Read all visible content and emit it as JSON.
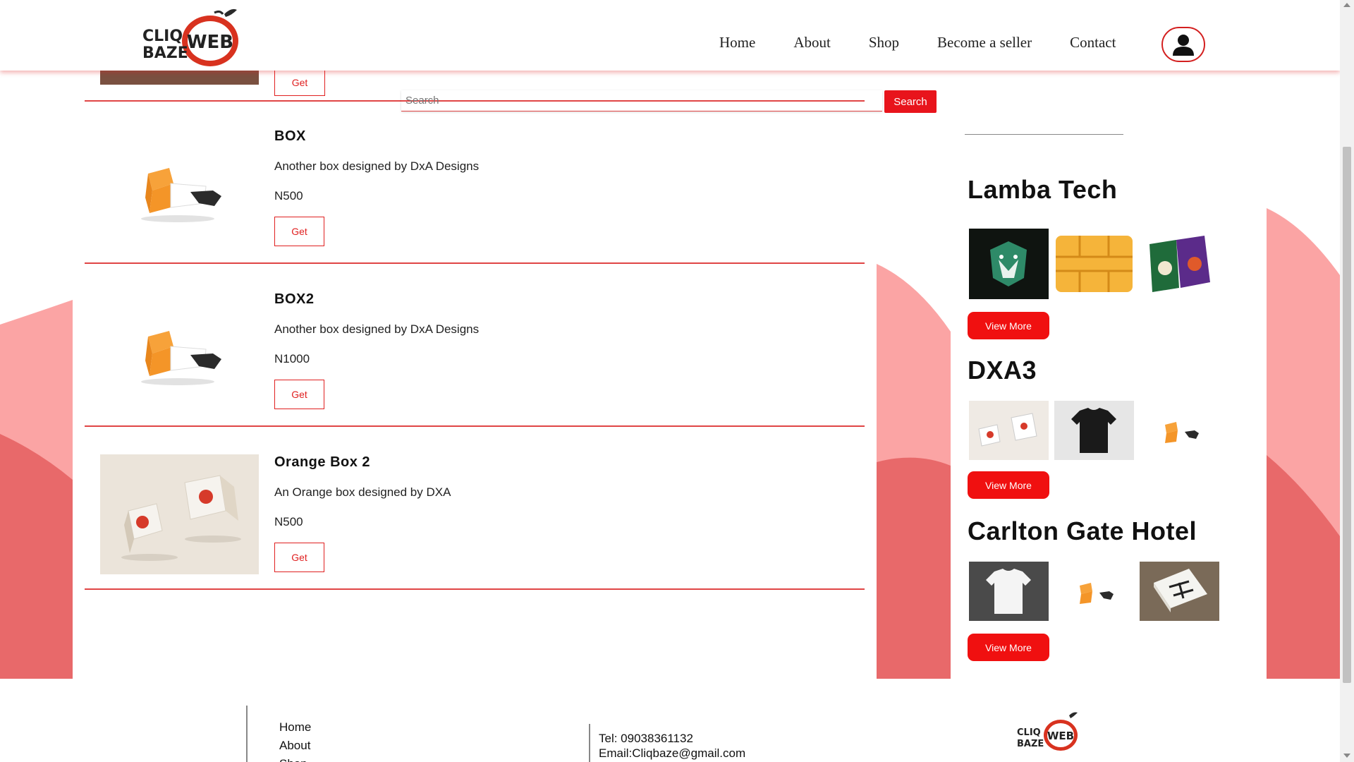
{
  "header": {
    "logo_text_top": "CLIQ",
    "logo_text_bottom": "BAZE",
    "logo_badge": "WEB",
    "nav": [
      "Home",
      "About",
      "Shop",
      "Become a seller",
      "Contact"
    ]
  },
  "search": {
    "placeholder": "Search",
    "button_label": "Search"
  },
  "top_partial_item": {
    "get_label": "Get"
  },
  "products": [
    {
      "name": "BOX",
      "description": "Another box designed by DxA Designs",
      "price": "N500",
      "get_label": "Get",
      "image": "orange-box-mockup"
    },
    {
      "name": "BOX2",
      "description": "Another box designed by DxA Designs",
      "price": "N1000",
      "get_label": "Get",
      "image": "orange-box-mockup"
    },
    {
      "name": "Orange Box 2",
      "description": "An Orange box designed by DXA",
      "price": "N500",
      "get_label": "Get",
      "image": "cliqbaze-tv-boxes"
    }
  ],
  "sidebar": {
    "sellers": [
      {
        "name": "Lamba Tech",
        "images": [
          "tiger-mascot",
          "sim-chip",
          "fuhmen-books"
        ],
        "button": "View More"
      },
      {
        "name": "DXA3",
        "images": [
          "cliqbaze-web-boxes",
          "black-tshirt",
          "orange-box-mockup"
        ],
        "button": "View More"
      },
      {
        "name": "Carlton Gate Hotel",
        "images": [
          "white-tshirt",
          "orange-box-mockup",
          "dxa-card-stack"
        ],
        "button": "View More"
      }
    ]
  },
  "footer": {
    "links": [
      "Home",
      "About",
      "Shop"
    ],
    "tel": "Tel: 09038361132",
    "email": "Email:Cliqbaze@gmail.com",
    "logo_text_top": "CLIQ",
    "logo_text_bottom": "BAZE",
    "logo_badge": "WEB"
  },
  "colors": {
    "accent": "#e8141c",
    "wave_light": "#fba4a4",
    "wave_dark": "#e8696a"
  }
}
